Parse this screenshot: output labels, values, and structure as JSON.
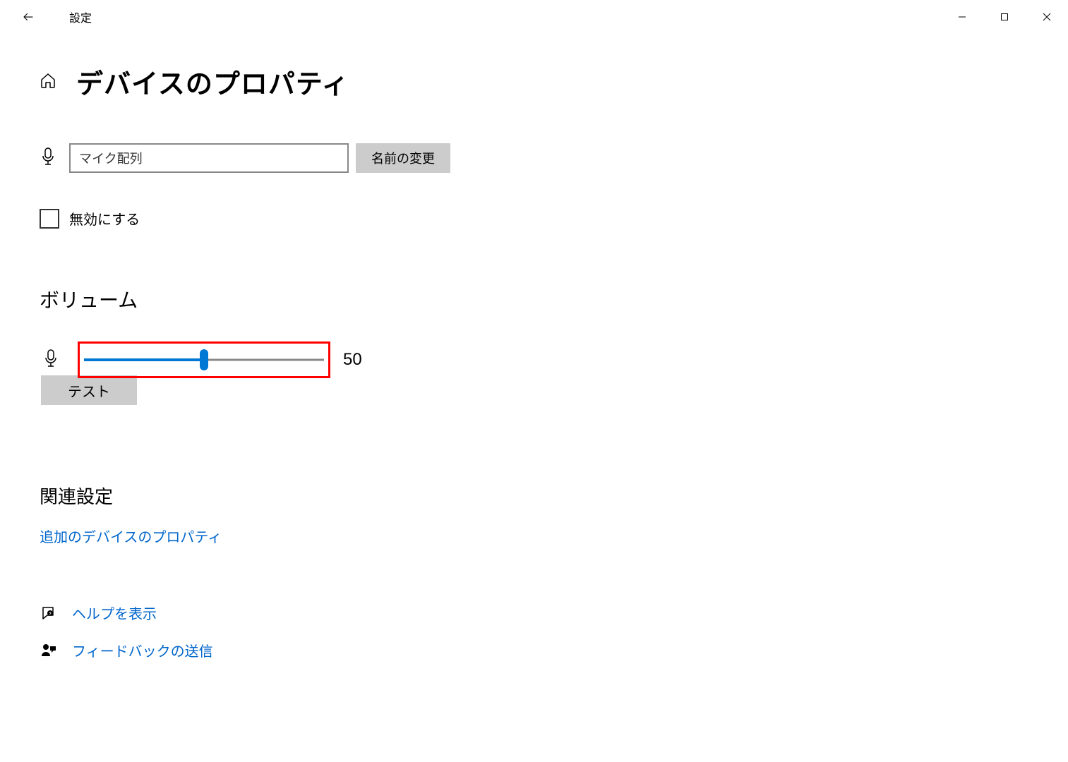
{
  "titlebar": {
    "app_title": "設定"
  },
  "page": {
    "title": "デバイスのプロパティ"
  },
  "device": {
    "name_value": "マイク配列",
    "rename_label": "名前の変更"
  },
  "disable": {
    "label": "無効にする",
    "checked": false
  },
  "volume": {
    "heading": "ボリューム",
    "value": "50",
    "percent": 50,
    "test_label": "テスト"
  },
  "related": {
    "heading": "関連設定",
    "additional_props_link": "追加のデバイスのプロパティ"
  },
  "footer": {
    "help_link": "ヘルプを表示",
    "feedback_link": "フィードバックの送信"
  }
}
